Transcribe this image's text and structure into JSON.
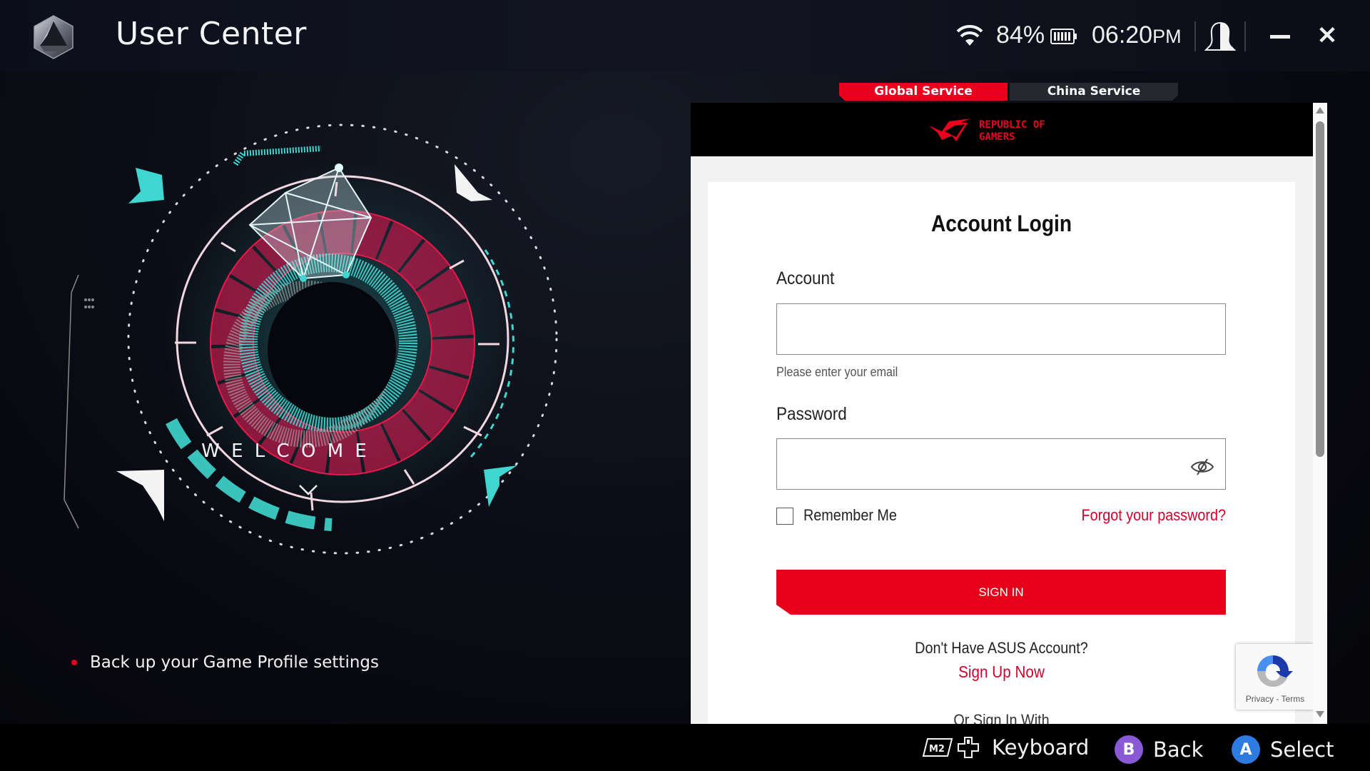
{
  "titlebar": {
    "app_title": "User Center",
    "battery_percent": "84%",
    "time": "06:20",
    "ampm": "PM",
    "icons": {
      "app_logo": "armoury-crate-logo-icon",
      "wifi": "wifi-icon",
      "battery": "battery-icon",
      "user": "user-profile-icon",
      "minimize": "minimize-icon",
      "close": "close-icon"
    },
    "close_glyph": "✕"
  },
  "hero": {
    "welcome_text": "W E L C O M E",
    "bullets": [
      {
        "text": "Back up your Game Profile settings"
      }
    ],
    "accent_colors": {
      "red": "#e8194a",
      "teal": "#3fd6cf"
    }
  },
  "service_tabs": [
    {
      "label": "Global Service",
      "active": true
    },
    {
      "label": "China Service",
      "active": false
    }
  ],
  "login": {
    "brand_text_line1": "REPUBLIC OF",
    "brand_text_line2": "GAMERS",
    "title": "Account Login",
    "account_label": "Account",
    "account_value": "",
    "account_hint": "Please enter your email",
    "password_label": "Password",
    "password_value": "",
    "remember_label": "Remember Me",
    "remember_checked": false,
    "forgot_link": "Forgot your password?",
    "signin_label": "SIGN IN",
    "no_account_text": "Don't Have ASUS Account?",
    "signup_link": "Sign Up Now",
    "or_signin_text": "Or Sign In With",
    "recaptcha_links": "Privacy - Terms"
  },
  "colors": {
    "brand_red": "#e60019",
    "link_red": "#d4002a",
    "tab_inactive": "#262830"
  },
  "hintbar": {
    "keyboard_badge": "M2",
    "keyboard_label": "Keyboard",
    "back_button": "B",
    "back_label": "Back",
    "select_button": "A",
    "select_label": "Select",
    "back_color": "#8a5ad6",
    "select_color": "#2d7be0"
  }
}
